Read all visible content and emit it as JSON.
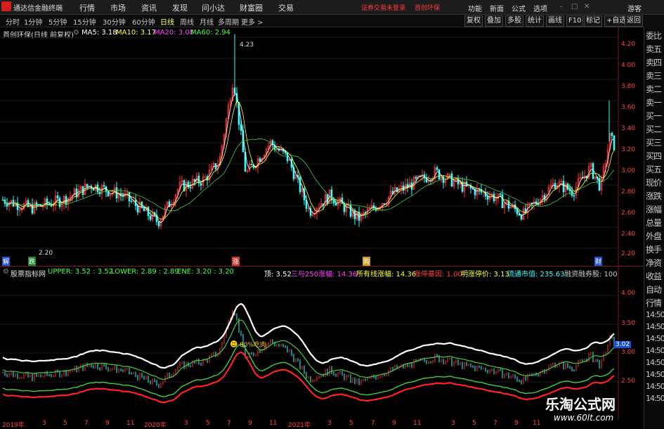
{
  "menubar": {
    "app_title": "通达信金融终端",
    "items": [
      "行情",
      "市场",
      "资讯",
      "发现",
      "问小达",
      "财富圈",
      "交易"
    ],
    "warning": "证券交易未登录",
    "stock_name": "首创环保",
    "right_items": [
      "功能",
      "新面",
      "公式",
      "选项",
      "游客"
    ]
  },
  "periodbar": {
    "periods": [
      "分时",
      "1分钟",
      "5分钟",
      "15分钟",
      "30分钟",
      "60分钟",
      "日线",
      "周线",
      "月线",
      "多周期",
      "更多 >"
    ],
    "active": "日线",
    "tools": [
      "复权",
      "叠加",
      "多股",
      "统计",
      "画线",
      "F10",
      "标记",
      "+自选",
      "返回"
    ]
  },
  "main_panel": {
    "header_name": "首创环保(日线 前复权)",
    "ma": [
      {
        "label": "MA5: 3.18",
        "color": "#ffffff"
      },
      {
        "label": "MA10: 3.17",
        "color": "#ffff44"
      },
      {
        "label": "MA20: 3.08",
        "color": "#ff44ff"
      },
      {
        "label": "MA60: 2.94",
        "color": "#44ff44"
      }
    ],
    "price_axis": [
      "4.20",
      "4.00",
      "3.80",
      "3.60",
      "3.40",
      "3.20",
      "3.00",
      "2.80",
      "2.60",
      "2.40",
      "2.20"
    ],
    "high_label": "4.23",
    "low_label": "2.20",
    "bottom_markers": [
      "解",
      "跌",
      "涨",
      "购",
      "财"
    ]
  },
  "indicator_panel": {
    "header_name": "股票指标网",
    "values": [
      {
        "label": "UPPER: 3.52 : 3.52",
        "color": "#44ff44"
      },
      {
        "label": "LOWER: 2.89 : 2.89",
        "color": "#44ff44"
      },
      {
        "label": "ENE: 3.20 : 3.20",
        "color": "#44ff44"
      },
      {
        "label": "顶: 3.52",
        "color": "#ffffff"
      },
      {
        "label": "三与250涨幅: 14.36",
        "color": "#ff44ff"
      },
      {
        "label": "所有线涨幅: 14.36",
        "color": "#ffff44"
      },
      {
        "label": "涨停基因: 1.00",
        "color": "#ff4444"
      },
      {
        "label": "明涨停价: 3.13",
        "color": "#ffff44"
      },
      {
        "label": "流通市值: 235.63",
        "color": "#44ffff"
      },
      {
        "label": "融资融券股: 100",
        "color": "#c8c8c8"
      }
    ],
    "axis": [
      "4.00",
      "3.50",
      "3.00",
      "2.50"
    ],
    "current_value": "3.02",
    "annotation": "80%吃肉"
  },
  "right_column": [
    "委比",
    "卖五",
    "卖四",
    "卖三",
    "卖二",
    "卖一",
    "买一",
    "买二",
    "买三",
    "买四",
    "买五",
    "现价",
    "涨跌",
    "涨幅",
    "总量",
    "外盘",
    "换手",
    "净资",
    "收益",
    "自动",
    "行情",
    "14:50",
    "14:50",
    "14:50",
    "14:50",
    "14:50",
    "14:50",
    "14:50",
    "14:50"
  ],
  "dates": [
    "2019年",
    "3",
    "5",
    "7",
    "9",
    "11",
    "2020年",
    "3",
    "5",
    "7",
    "9",
    "11",
    "2021年",
    "3",
    "5",
    "7",
    "9",
    "11",
    "3",
    "5",
    "7",
    "9",
    "11"
  ],
  "watermark": {
    "title": "乐淘公式网",
    "url": "www.60lt.com"
  },
  "colors": {
    "up": "#ff3333",
    "down": "#33ffff",
    "ma5": "#ffffff",
    "ma60": "#44cc44",
    "axis": "#ff4444"
  }
}
